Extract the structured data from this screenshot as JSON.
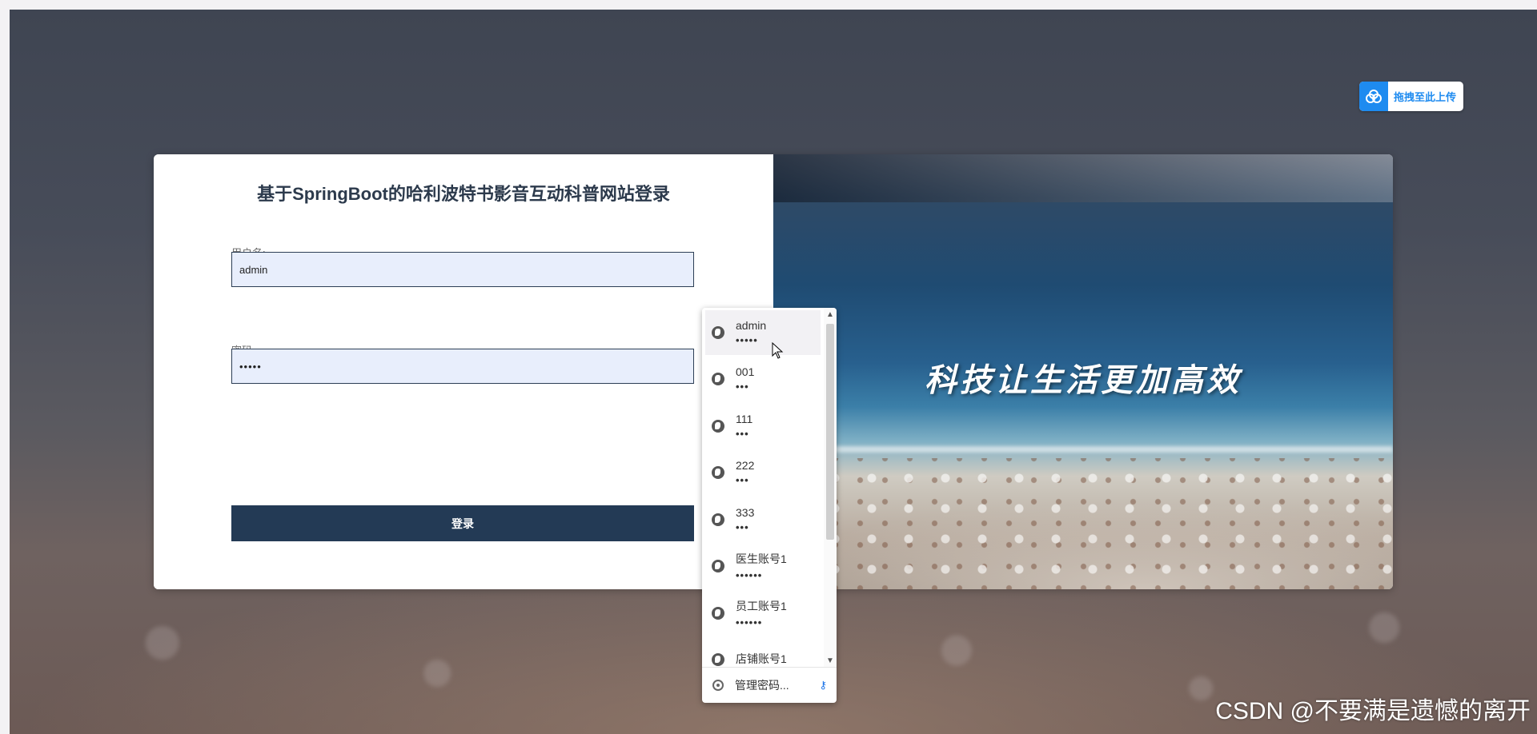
{
  "upload_badge": {
    "label": "拖拽至此上传",
    "icon": "cloud-upload-icon",
    "color": "#1e8bf0"
  },
  "login": {
    "title": "基于SpringBoot的哈利波特书影音互动科普网站登录",
    "username_label": "用户名:",
    "username_value": "admin",
    "password_label": "密码:",
    "password_value": "•••••",
    "submit_label": "登录",
    "accent_color": "#233a55"
  },
  "hero": {
    "slogan": "科技让生活更加高效"
  },
  "password_popup": {
    "items": [
      {
        "username": "admin",
        "password": "•••••"
      },
      {
        "username": "001",
        "password": "•••"
      },
      {
        "username": "111",
        "password": "•••"
      },
      {
        "username": "222",
        "password": "•••"
      },
      {
        "username": "333",
        "password": "•••"
      },
      {
        "username": "医生账号1",
        "password": "••••••"
      },
      {
        "username": "员工账号1",
        "password": "••••••"
      },
      {
        "username": "店铺账号1",
        "password": ""
      }
    ],
    "manage_label": "管理密码...",
    "scroll_up": "▲",
    "scroll_down": "▼",
    "key_icon": "⚷"
  },
  "watermark": "CSDN @不要满是遗憾的离开"
}
